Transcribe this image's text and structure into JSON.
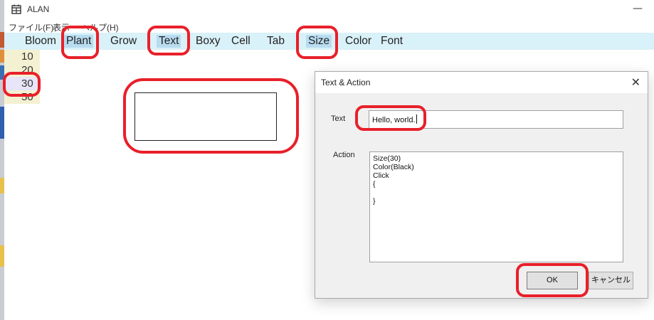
{
  "window": {
    "title": "ALAN",
    "minimize_glyph": "—",
    "icon": "calendar-app-icon"
  },
  "menu": {
    "file": "ファイル(F)",
    "view": "表示",
    "help": "ヘルプ(H)"
  },
  "toolbar": {
    "items": [
      {
        "label": "Bloom",
        "selected": false
      },
      {
        "label": "Plant",
        "selected": true
      },
      {
        "label": "Grow",
        "selected": false
      },
      {
        "label": "Text",
        "selected": true
      },
      {
        "label": "Boxy",
        "selected": false
      },
      {
        "label": "Cell",
        "selected": false
      },
      {
        "label": "Tab",
        "selected": false
      },
      {
        "label": "Size",
        "selected": true
      },
      {
        "label": "Color",
        "selected": false
      },
      {
        "label": "Font",
        "selected": false
      }
    ]
  },
  "sizes": {
    "items": [
      "10",
      "20",
      "30",
      "50"
    ],
    "selected": "30"
  },
  "dialog": {
    "title": "Text & Action",
    "close_glyph": "✕",
    "text_label": "Text",
    "text_value": "Hello, world.",
    "action_label": "Action",
    "action_value": "Size(30)\nColor(Black)\nClick\n{\n\n}",
    "ok_label": "OK",
    "cancel_label": "キャンセル"
  },
  "colors": {
    "toolbar_bg": "#d9f1f8",
    "selected_bg": "#b8dcf0",
    "annotation": "#e8202a"
  }
}
